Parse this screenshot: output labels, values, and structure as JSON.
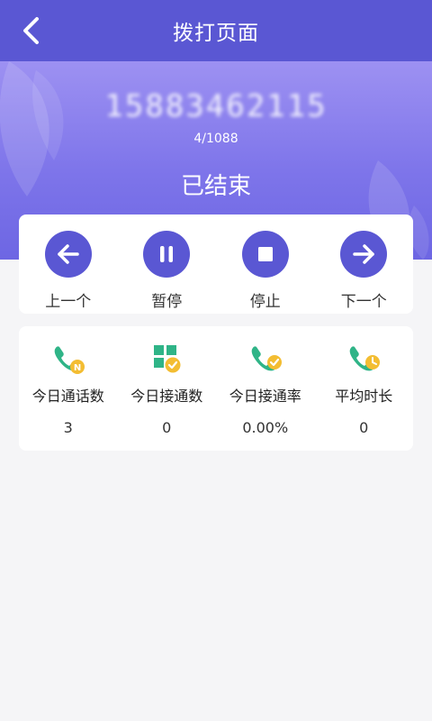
{
  "header": {
    "title": "拨打页面"
  },
  "call": {
    "phone_number": "15883462115",
    "progress": "4/1088",
    "status": "已结束"
  },
  "controls": [
    {
      "label": "上一个",
      "icon": "arrow-left-icon"
    },
    {
      "label": "暂停",
      "icon": "pause-icon"
    },
    {
      "label": "停止",
      "icon": "stop-icon"
    },
    {
      "label": "下一个",
      "icon": "arrow-right-icon"
    }
  ],
  "stats": [
    {
      "label": "今日通话数",
      "value": "3",
      "icon": "phone-n-icon"
    },
    {
      "label": "今日接通数",
      "value": "0",
      "icon": "grid-check-icon"
    },
    {
      "label": "今日接通率",
      "value": "0.00%",
      "icon": "phone-check-icon"
    },
    {
      "label": "平均时长",
      "value": "0",
      "icon": "phone-clock-icon"
    }
  ],
  "colors": {
    "primary": "#5a57d3",
    "hero_top": "#9d91f2",
    "hero_bottom": "#6d66e3",
    "icon_green": "#2fb487",
    "icon_yellow": "#f3bd32",
    "background": "#f5f5f7"
  }
}
